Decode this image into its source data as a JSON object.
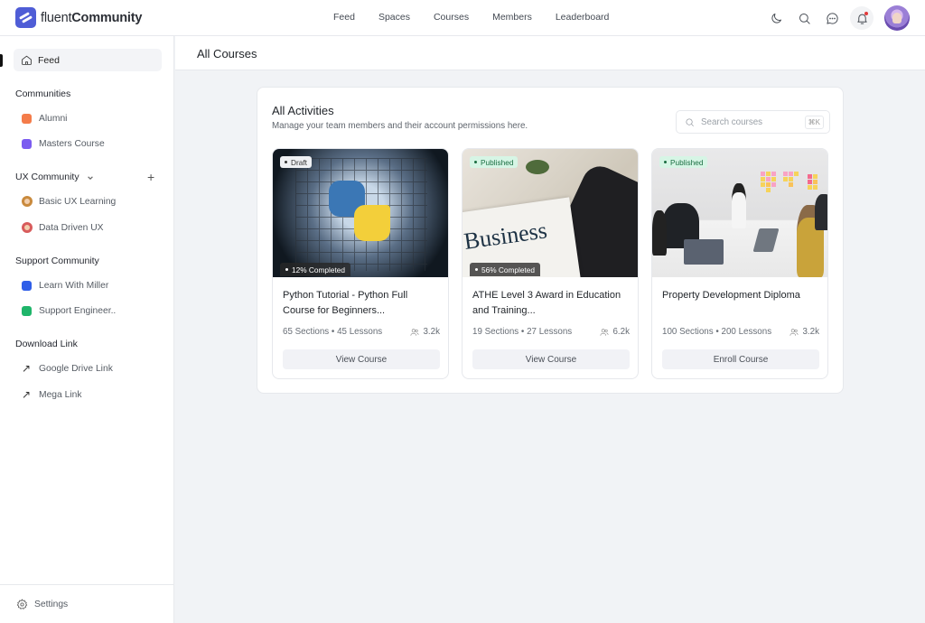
{
  "app": {
    "logo_light": "fluent",
    "logo_bold": "Community"
  },
  "topnav": [
    {
      "label": "Feed"
    },
    {
      "label": "Spaces"
    },
    {
      "label": "Courses"
    },
    {
      "label": "Members"
    },
    {
      "label": "Leaderboard"
    }
  ],
  "top_icons": [
    "moon-icon",
    "search-icon",
    "chat-icon",
    "bell-icon",
    "user-avatar"
  ],
  "sidebar": {
    "feed_label": "Feed",
    "sections": [
      {
        "title": "Communities",
        "items": [
          {
            "label": "Alumni",
            "color": "#f47c4a"
          },
          {
            "label": "Masters Course",
            "color": "#7b5cf0"
          }
        ]
      },
      {
        "title": "UX Community",
        "items": [
          {
            "label": "Basic UX Learning",
            "avatar_color": "#c98a3d"
          },
          {
            "label": "Data Driven UX",
            "avatar_color": "#d85c5c"
          }
        ]
      },
      {
        "title": "Support Community",
        "items": [
          {
            "label": "Learn With Miller",
            "color": "#2f5ee8"
          },
          {
            "label": "Support Engineer..",
            "color": "#1fb56a"
          }
        ]
      },
      {
        "title": "Download Link",
        "items": [
          {
            "label": "Google Drive Link",
            "icon": "↗"
          },
          {
            "label": "Mega Link",
            "icon": "↗"
          }
        ]
      }
    ],
    "settings_label": "Settings"
  },
  "page": {
    "title": "All Courses"
  },
  "panel": {
    "title": "All Activities",
    "subtitle": "Manage your team members and their account permissions here.",
    "search_placeholder": "Search courses",
    "search_shortcut": "⌘K"
  },
  "courses": [
    {
      "status": "Draft",
      "progress": "12% Completed",
      "title": "Python Tutorial - Python Full Course for Beginners...",
      "sections": "65 Sections",
      "lessons": "45 Lessons",
      "students": "3.2k",
      "button": "View Course"
    },
    {
      "status": "Published",
      "progress": "56% Completed",
      "title": "ATHE Level 3 Award in Education and Training...",
      "sections": "19 Sections",
      "lessons": "27 Lessons",
      "students": "6.2k",
      "button": "View Course",
      "image_text": "Business"
    },
    {
      "status": "Published",
      "progress": null,
      "title": "Property Development Diploma",
      "sections": "100 Sections",
      "lessons": "200 Lessons",
      "students": "3.2k",
      "button": "Enroll Course"
    }
  ],
  "meta_separator": " • "
}
